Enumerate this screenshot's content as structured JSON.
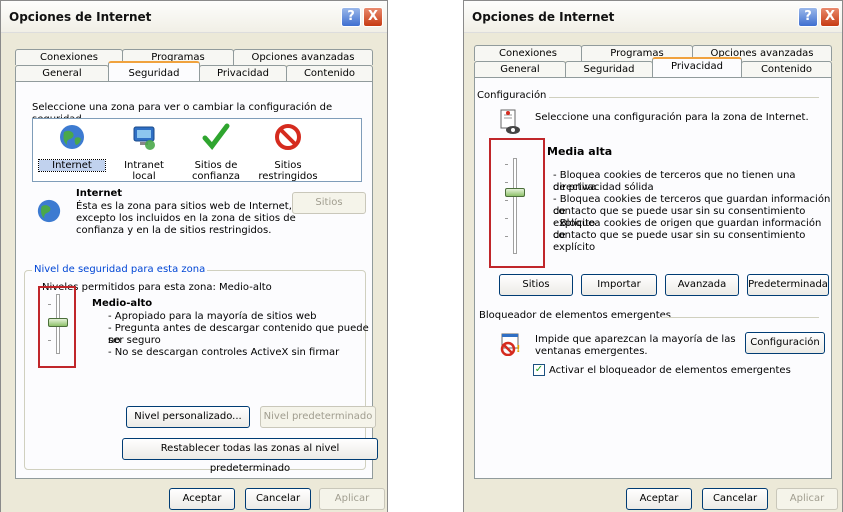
{
  "left": {
    "title": "Opciones de Internet",
    "help": "?",
    "close": "X",
    "tabs_row1": [
      "Conexiones",
      "Programas",
      "Opciones avanzadas"
    ],
    "tabs_row2": [
      "General",
      "Seguridad",
      "Privacidad",
      "Contenido"
    ],
    "selected_tab": "Seguridad",
    "intro": "Seleccione una zona para ver o cambiar la configuración de seguridad.",
    "zones": [
      {
        "line1": "Internet",
        "line2": "",
        "icon": "globe-icon"
      },
      {
        "line1": "Intranet local",
        "line2": "",
        "icon": "computer-icon"
      },
      {
        "line1": "Sitios de",
        "line2": "confianza",
        "icon": "checkmark-icon"
      },
      {
        "line1": "Sitios",
        "line2": "restringidos",
        "icon": "prohibited-icon"
      }
    ],
    "zone_heading": "Internet",
    "zone_desc": [
      "Ésta es la zona para sitios web de Internet,",
      "excepto los incluidos en la zona de sitios de",
      "confianza y en la de sitios restringidos."
    ],
    "sites_button": "Sitios",
    "level_group_label": "Nivel de seguridad para esta zona",
    "allowed_levels": "Niveles permitidos para esta zona: Medio-alto",
    "level_name": "Medio-alto",
    "level_desc": [
      "- Apropiado para la mayoría de sitios web",
      "- Pregunta antes de descargar contenido que puede no",
      "ser seguro",
      "- No se descargan controles ActiveX sin firmar"
    ],
    "custom_button": "Nivel personalizado...",
    "default_button": "Nivel predeterminado",
    "reset_button": "Restablecer todas las zonas al nivel predeterminado",
    "ok": "Aceptar",
    "cancel": "Cancelar",
    "apply": "Aplicar"
  },
  "right": {
    "title": "Opciones de Internet",
    "help": "?",
    "close": "X",
    "tabs_row1": [
      "Conexiones",
      "Programas",
      "Opciones avanzadas"
    ],
    "tabs_row2": [
      "General",
      "Seguridad",
      "Privacidad",
      "Contenido"
    ],
    "selected_tab": "Privacidad",
    "config_label": "Configuración",
    "config_intro": "Seleccione una configuración para la zona de Internet.",
    "level_name": "Media alta",
    "level_desc": [
      "- Bloquea cookies de terceros que no tienen una directiva",
      "de privacidad sólida",
      "- Bloquea cookies de terceros que guardan información de",
      "contacto que se puede usar sin su consentimiento explícito",
      "- Bloquea cookies de origen que guardan información de",
      "contacto que se  puede usar sin su consentimiento explícito"
    ],
    "buttons": [
      "Sitios",
      "Importar",
      "Avanzada",
      "Predeterminada"
    ],
    "popup_label": "Bloqueador de elementos emergentes",
    "popup_desc": [
      "Impide que aparezcan la mayoría de las",
      "ventanas emergentes."
    ],
    "popup_config": "Configuración",
    "popup_check": "Activar el bloqueador de elementos emergentes",
    "popup_checked": true,
    "ok": "Aceptar",
    "cancel": "Cancelar",
    "apply": "Aplicar"
  },
  "colors": {
    "highlight": "#c0262a",
    "tab_accent": "#f0a23e",
    "dialog_bg": "#ece9d8"
  }
}
